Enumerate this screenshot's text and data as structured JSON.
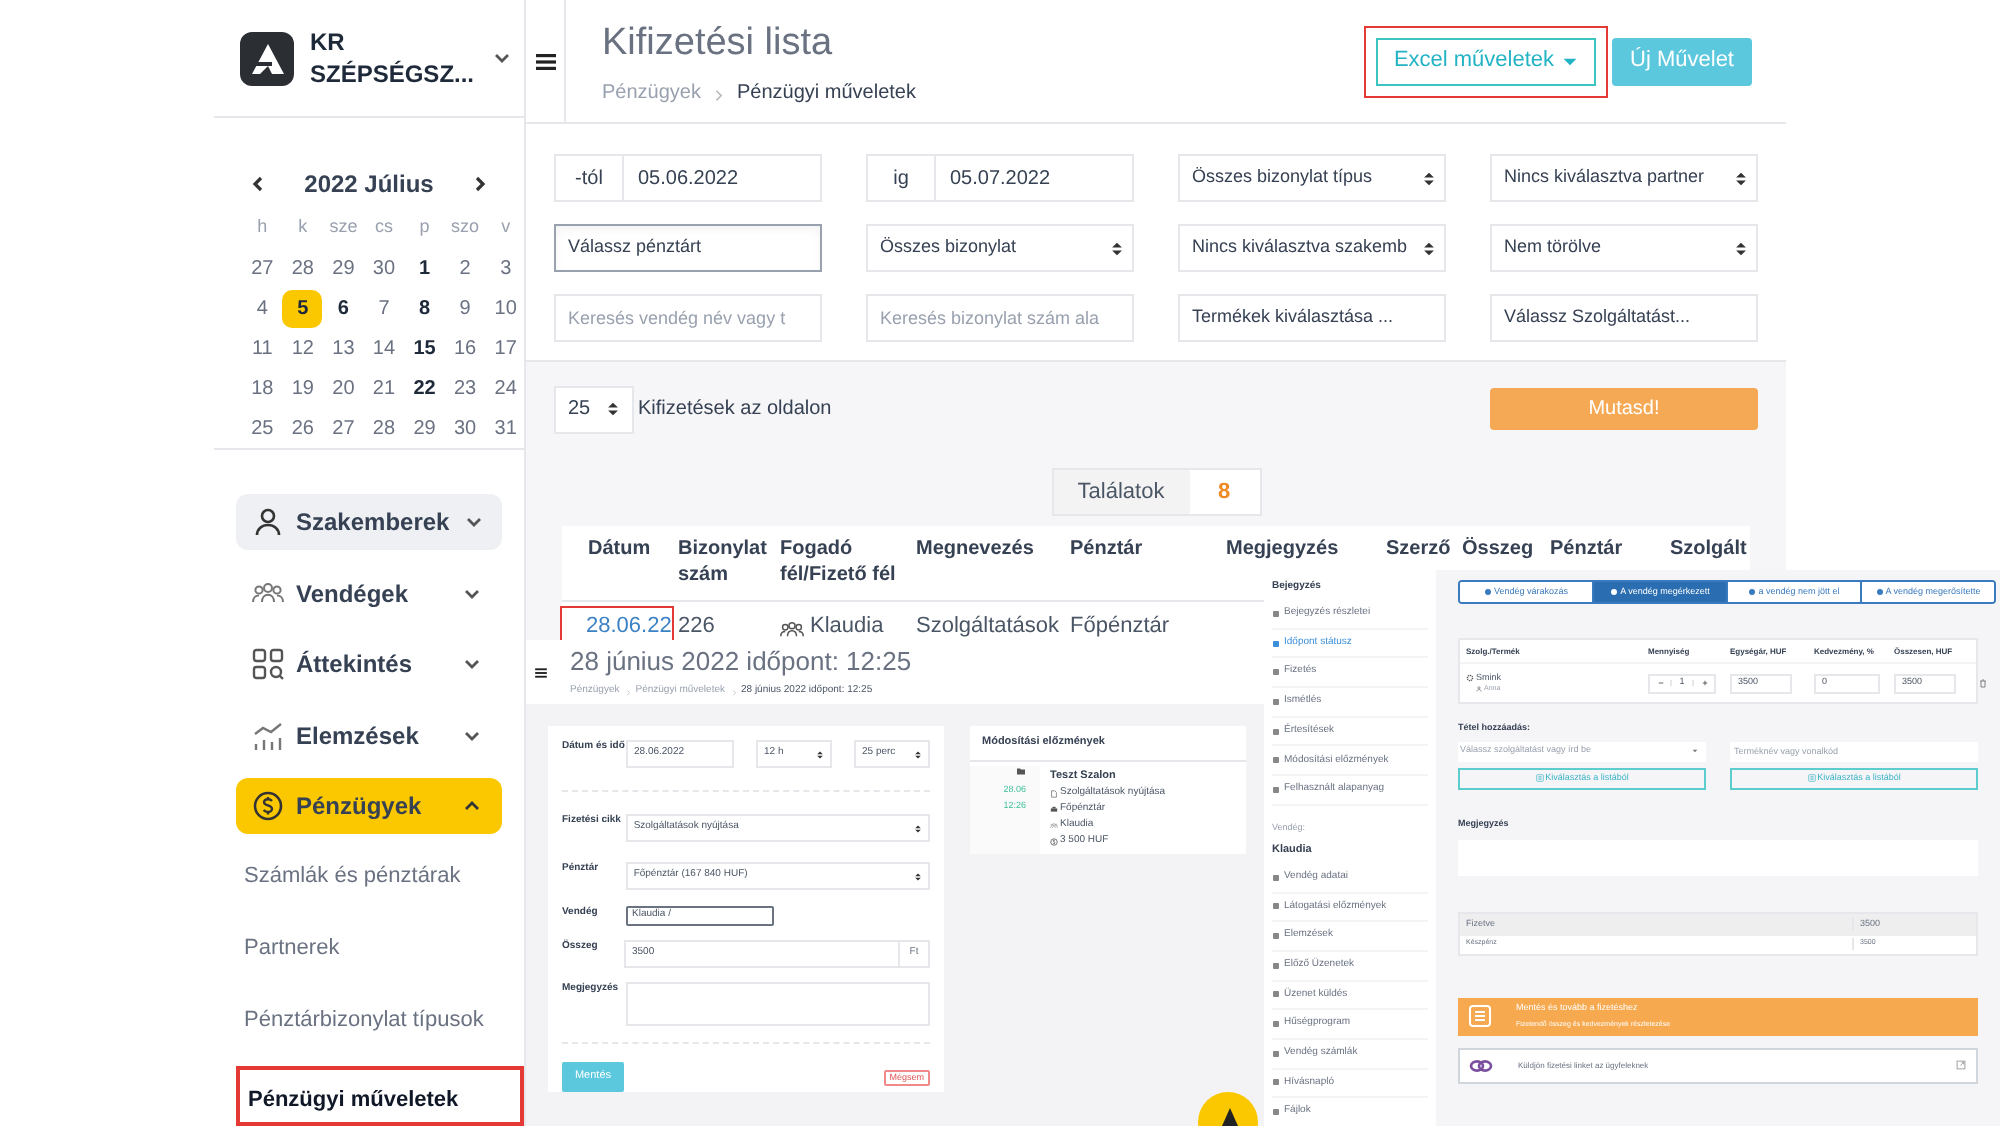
{
  "sidebar": {
    "company": "KR SZÉPSÉGSZ...",
    "calendar": {
      "title": "2022 Július",
      "weekdays": [
        "h",
        "k",
        "sze",
        "cs",
        "p",
        "szo",
        "v"
      ],
      "weeks": [
        [
          {
            "label": "27",
            "bold": false,
            "selected": false
          },
          {
            "label": "28",
            "bold": false,
            "selected": false
          },
          {
            "label": "29",
            "bold": false,
            "selected": false
          },
          {
            "label": "30",
            "bold": false,
            "selected": false
          },
          {
            "label": "1",
            "bold": true,
            "selected": false
          },
          {
            "label": "2",
            "bold": false,
            "selected": false
          },
          {
            "label": "3",
            "bold": false,
            "selected": false
          }
        ],
        [
          {
            "label": "4",
            "bold": false,
            "selected": false
          },
          {
            "label": "5",
            "bold": true,
            "selected": true
          },
          {
            "label": "6",
            "bold": true,
            "selected": false
          },
          {
            "label": "7",
            "bold": false,
            "selected": false
          },
          {
            "label": "8",
            "bold": true,
            "selected": false
          },
          {
            "label": "9",
            "bold": false,
            "selected": false
          },
          {
            "label": "10",
            "bold": false,
            "selected": false
          }
        ],
        [
          {
            "label": "11",
            "bold": false,
            "selected": false
          },
          {
            "label": "12",
            "bold": false,
            "selected": false
          },
          {
            "label": "13",
            "bold": false,
            "selected": false
          },
          {
            "label": "14",
            "bold": false,
            "selected": false
          },
          {
            "label": "15",
            "bold": true,
            "selected": false
          },
          {
            "label": "16",
            "bold": false,
            "selected": false
          },
          {
            "label": "17",
            "bold": false,
            "selected": false
          }
        ],
        [
          {
            "label": "18",
            "bold": false,
            "selected": false
          },
          {
            "label": "19",
            "bold": false,
            "selected": false
          },
          {
            "label": "20",
            "bold": false,
            "selected": false
          },
          {
            "label": "21",
            "bold": false,
            "selected": false
          },
          {
            "label": "22",
            "bold": true,
            "selected": false
          },
          {
            "label": "23",
            "bold": false,
            "selected": false
          },
          {
            "label": "24",
            "bold": false,
            "selected": false
          }
        ],
        [
          {
            "label": "25",
            "bold": false,
            "selected": false
          },
          {
            "label": "26",
            "bold": false,
            "selected": false
          },
          {
            "label": "27",
            "bold": false,
            "selected": false
          },
          {
            "label": "28",
            "bold": false,
            "selected": false
          },
          {
            "label": "29",
            "bold": false,
            "selected": false
          },
          {
            "label": "30",
            "bold": false,
            "selected": false
          },
          {
            "label": "31",
            "bold": false,
            "selected": false
          }
        ]
      ]
    },
    "nav": [
      {
        "label": "Szakemberek",
        "hovered": true,
        "selected": false,
        "expanded": false
      },
      {
        "label": "Vendégek",
        "hovered": false,
        "selected": false,
        "expanded": false
      },
      {
        "label": "Áttekintés",
        "hovered": false,
        "selected": false,
        "expanded": false
      },
      {
        "label": "Elemzések",
        "hovered": false,
        "selected": false,
        "expanded": false
      },
      {
        "label": "Pénzügyek",
        "hovered": false,
        "selected": true,
        "expanded": true,
        "children": [
          {
            "label": "Számlák és pénztárak",
            "selected": false,
            "highlighted": false
          },
          {
            "label": "Partnerek",
            "selected": false,
            "highlighted": false
          },
          {
            "label": "Pénztárbizonylat típusok",
            "selected": false,
            "highlighted": false
          },
          {
            "label": "Pénzügyi műveletek",
            "selected": true,
            "highlighted": true
          }
        ]
      }
    ]
  },
  "header": {
    "title": "Kifizetési lista",
    "breadcrumb": [
      "Pénzügyek",
      "Pénzügyi műveletek"
    ],
    "excel_button": {
      "label": "Excel műveletek",
      "highlighted": true
    },
    "new_button": "Új Művelet"
  },
  "filters": [
    {
      "kind": "date",
      "prefix": "-tól",
      "value": "05.06.2022"
    },
    {
      "kind": "date",
      "prefix": "ig",
      "value": "05.07.2022"
    },
    {
      "kind": "select",
      "value": "Összes bizonylat típus"
    },
    {
      "kind": "select",
      "value": "Nincs kiválasztva partner"
    },
    {
      "kind": "picker",
      "value": "Válassz pénztárt",
      "focused": true
    },
    {
      "kind": "select",
      "value": "Összes bizonylat"
    },
    {
      "kind": "select",
      "value": "Nincs kiválasztva szakemb"
    },
    {
      "kind": "select",
      "value": "Nem törölve"
    },
    {
      "kind": "search",
      "placeholder": "Keresés vendég név vagy t"
    },
    {
      "kind": "search",
      "placeholder": "Keresés bizonylat szám ala"
    },
    {
      "kind": "picker",
      "value": "Termékek kiválasztása ...",
      "focused": false
    },
    {
      "kind": "picker",
      "value": "Válassz Szolgáltatást...",
      "focused": false
    }
  ],
  "paging": {
    "per_page": "25",
    "label": "Kifizetések az oldalon",
    "show_button": "Mutasd!"
  },
  "results": {
    "label": "Találatok",
    "count": "8"
  },
  "table": {
    "columns": [
      "Dátum",
      "Bizonylat szám",
      "Fogadó fél/Fizető fél",
      "Megnevezés",
      "Pénztár",
      "Megjegyzés",
      "Szerző",
      "Összeg",
      "Pénztár",
      "Szolgált"
    ],
    "rows": [
      {
        "cells": [
          "28.06.22",
          "226",
          "Klaudia",
          "Szolgáltatások",
          "Főpénztár"
        ],
        "date_highlighted": true
      }
    ]
  },
  "detail": {
    "title": "28 június 2022 időpont: 12:25",
    "breadcrumb": [
      "Pénzügyek",
      "Pénzügyi műveletek",
      "28 június 2022 időpont: 12:25"
    ],
    "form": [
      {
        "kind": "datetime",
        "label": "Dátum és idő",
        "values": [
          "28.06.2022",
          "12 h",
          "25 perc"
        ]
      },
      {
        "kind": "select",
        "label": "Fizetési cikk",
        "value": "Szolgáltatások nyújtása"
      },
      {
        "kind": "select",
        "label": "Pénztár",
        "value": "Főpénztár (167 840 HUF)"
      },
      {
        "kind": "input",
        "label": "Vendég",
        "value": "Klaudia /"
      },
      {
        "kind": "amount",
        "label": "Összeg",
        "value": "3500",
        "unit": "Ft"
      },
      {
        "kind": "textarea",
        "label": "Megjegyzés"
      }
    ],
    "save_button": "Mentés",
    "cancel_button": "Mégsem",
    "history": {
      "title": "Módosítási előzmények",
      "date": "28.06",
      "time": "12:26",
      "entry_title": "Teszt Szalon",
      "lines": [
        "Szolgáltatások nyújtása",
        "Főpénztár",
        "Klaudia",
        "3 500 HUF"
      ]
    }
  },
  "entry_menu": {
    "heading": "Bejegyzés",
    "items": [
      {
        "label": "Bejegyzés részletei",
        "selected": false
      },
      {
        "label": "Időpont státusz",
        "selected": true
      },
      {
        "label": "Fizetés",
        "selected": false
      },
      {
        "label": "Ismétlés",
        "selected": false
      },
      {
        "label": "Értesítések",
        "selected": false
      },
      {
        "label": "Módosítási előzmények",
        "selected": false
      },
      {
        "label": "Felhasznált alapanyag",
        "selected": false
      }
    ],
    "guest_label": "Vendég:",
    "guest_name": "Klaudia",
    "guest_items": [
      "Vendég adatai",
      "Látogatási előzmények",
      "Elemzések",
      "Előző Üzenetek",
      "Üzenet küldés",
      "Hűségprogram",
      "Vendég számlák",
      "Hívásnapló",
      "Fájlok"
    ]
  },
  "appointment": {
    "status_tabs": [
      {
        "label": "Vendég várakozás",
        "selected": false
      },
      {
        "label": "A vendég megérkezett",
        "selected": true
      },
      {
        "label": "a vendég nem jött el",
        "selected": false
      },
      {
        "label": "A vendég megerősítette",
        "selected": false
      }
    ],
    "item_columns": [
      "Szolg./Termék",
      "Mennyiség",
      "Egységár, HUF",
      "Kedvezmény, %",
      "Összesen, HUF"
    ],
    "item": {
      "name": "Smink",
      "staff": "Anna",
      "quantity": "1",
      "unit_price": "3500",
      "discount": "0",
      "total": "3500"
    },
    "add_label": "Tétel hozzáadás:",
    "service_placeholder": "Válassz szolgáltatást vagy írd be",
    "product_placeholder": "Terméknév vagy vonalkód",
    "list_buttons": [
      "Kiválasztás a listából",
      "Kiválasztás a listából"
    ],
    "note_label": "Megjegyzés",
    "payments": [
      {
        "label": "Fizetve",
        "amount": "3500"
      },
      {
        "label": "Készpénz",
        "amount": "3500"
      }
    ],
    "pay_banner": {
      "title": "Mentés és tovább a fizetéshez",
      "subtitle": "Fizetendő összeg és kedvezmények részletezése"
    },
    "link_box": "Küldjön fizetési linket az ügyfeleknek"
  }
}
